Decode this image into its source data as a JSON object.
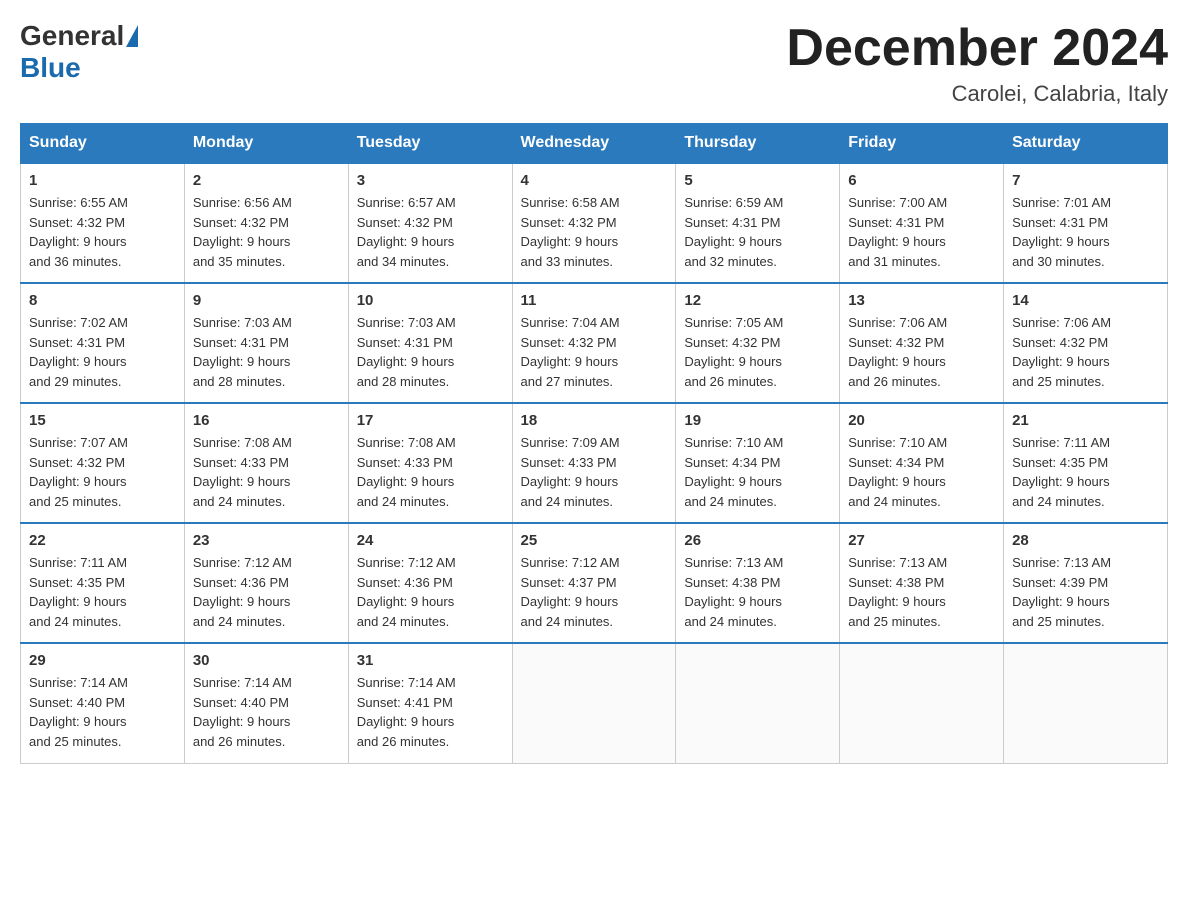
{
  "header": {
    "logo_general": "General",
    "logo_blue": "Blue",
    "title": "December 2024",
    "subtitle": "Carolei, Calabria, Italy"
  },
  "days_of_week": [
    "Sunday",
    "Monday",
    "Tuesday",
    "Wednesday",
    "Thursday",
    "Friday",
    "Saturday"
  ],
  "weeks": [
    [
      {
        "day": "1",
        "sunrise": "6:55 AM",
        "sunset": "4:32 PM",
        "daylight": "9 hours and 36 minutes."
      },
      {
        "day": "2",
        "sunrise": "6:56 AM",
        "sunset": "4:32 PM",
        "daylight": "9 hours and 35 minutes."
      },
      {
        "day": "3",
        "sunrise": "6:57 AM",
        "sunset": "4:32 PM",
        "daylight": "9 hours and 34 minutes."
      },
      {
        "day": "4",
        "sunrise": "6:58 AM",
        "sunset": "4:32 PM",
        "daylight": "9 hours and 33 minutes."
      },
      {
        "day": "5",
        "sunrise": "6:59 AM",
        "sunset": "4:31 PM",
        "daylight": "9 hours and 32 minutes."
      },
      {
        "day": "6",
        "sunrise": "7:00 AM",
        "sunset": "4:31 PM",
        "daylight": "9 hours and 31 minutes."
      },
      {
        "day": "7",
        "sunrise": "7:01 AM",
        "sunset": "4:31 PM",
        "daylight": "9 hours and 30 minutes."
      }
    ],
    [
      {
        "day": "8",
        "sunrise": "7:02 AM",
        "sunset": "4:31 PM",
        "daylight": "9 hours and 29 minutes."
      },
      {
        "day": "9",
        "sunrise": "7:03 AM",
        "sunset": "4:31 PM",
        "daylight": "9 hours and 28 minutes."
      },
      {
        "day": "10",
        "sunrise": "7:03 AM",
        "sunset": "4:31 PM",
        "daylight": "9 hours and 28 minutes."
      },
      {
        "day": "11",
        "sunrise": "7:04 AM",
        "sunset": "4:32 PM",
        "daylight": "9 hours and 27 minutes."
      },
      {
        "day": "12",
        "sunrise": "7:05 AM",
        "sunset": "4:32 PM",
        "daylight": "9 hours and 26 minutes."
      },
      {
        "day": "13",
        "sunrise": "7:06 AM",
        "sunset": "4:32 PM",
        "daylight": "9 hours and 26 minutes."
      },
      {
        "day": "14",
        "sunrise": "7:06 AM",
        "sunset": "4:32 PM",
        "daylight": "9 hours and 25 minutes."
      }
    ],
    [
      {
        "day": "15",
        "sunrise": "7:07 AM",
        "sunset": "4:32 PM",
        "daylight": "9 hours and 25 minutes."
      },
      {
        "day": "16",
        "sunrise": "7:08 AM",
        "sunset": "4:33 PM",
        "daylight": "9 hours and 24 minutes."
      },
      {
        "day": "17",
        "sunrise": "7:08 AM",
        "sunset": "4:33 PM",
        "daylight": "9 hours and 24 minutes."
      },
      {
        "day": "18",
        "sunrise": "7:09 AM",
        "sunset": "4:33 PM",
        "daylight": "9 hours and 24 minutes."
      },
      {
        "day": "19",
        "sunrise": "7:10 AM",
        "sunset": "4:34 PM",
        "daylight": "9 hours and 24 minutes."
      },
      {
        "day": "20",
        "sunrise": "7:10 AM",
        "sunset": "4:34 PM",
        "daylight": "9 hours and 24 minutes."
      },
      {
        "day": "21",
        "sunrise": "7:11 AM",
        "sunset": "4:35 PM",
        "daylight": "9 hours and 24 minutes."
      }
    ],
    [
      {
        "day": "22",
        "sunrise": "7:11 AM",
        "sunset": "4:35 PM",
        "daylight": "9 hours and 24 minutes."
      },
      {
        "day": "23",
        "sunrise": "7:12 AM",
        "sunset": "4:36 PM",
        "daylight": "9 hours and 24 minutes."
      },
      {
        "day": "24",
        "sunrise": "7:12 AM",
        "sunset": "4:36 PM",
        "daylight": "9 hours and 24 minutes."
      },
      {
        "day": "25",
        "sunrise": "7:12 AM",
        "sunset": "4:37 PM",
        "daylight": "9 hours and 24 minutes."
      },
      {
        "day": "26",
        "sunrise": "7:13 AM",
        "sunset": "4:38 PM",
        "daylight": "9 hours and 24 minutes."
      },
      {
        "day": "27",
        "sunrise": "7:13 AM",
        "sunset": "4:38 PM",
        "daylight": "9 hours and 25 minutes."
      },
      {
        "day": "28",
        "sunrise": "7:13 AM",
        "sunset": "4:39 PM",
        "daylight": "9 hours and 25 minutes."
      }
    ],
    [
      {
        "day": "29",
        "sunrise": "7:14 AM",
        "sunset": "4:40 PM",
        "daylight": "9 hours and 25 minutes."
      },
      {
        "day": "30",
        "sunrise": "7:14 AM",
        "sunset": "4:40 PM",
        "daylight": "9 hours and 26 minutes."
      },
      {
        "day": "31",
        "sunrise": "7:14 AM",
        "sunset": "4:41 PM",
        "daylight": "9 hours and 26 minutes."
      },
      null,
      null,
      null,
      null
    ]
  ],
  "labels": {
    "sunrise": "Sunrise:",
    "sunset": "Sunset:",
    "daylight": "Daylight:"
  }
}
